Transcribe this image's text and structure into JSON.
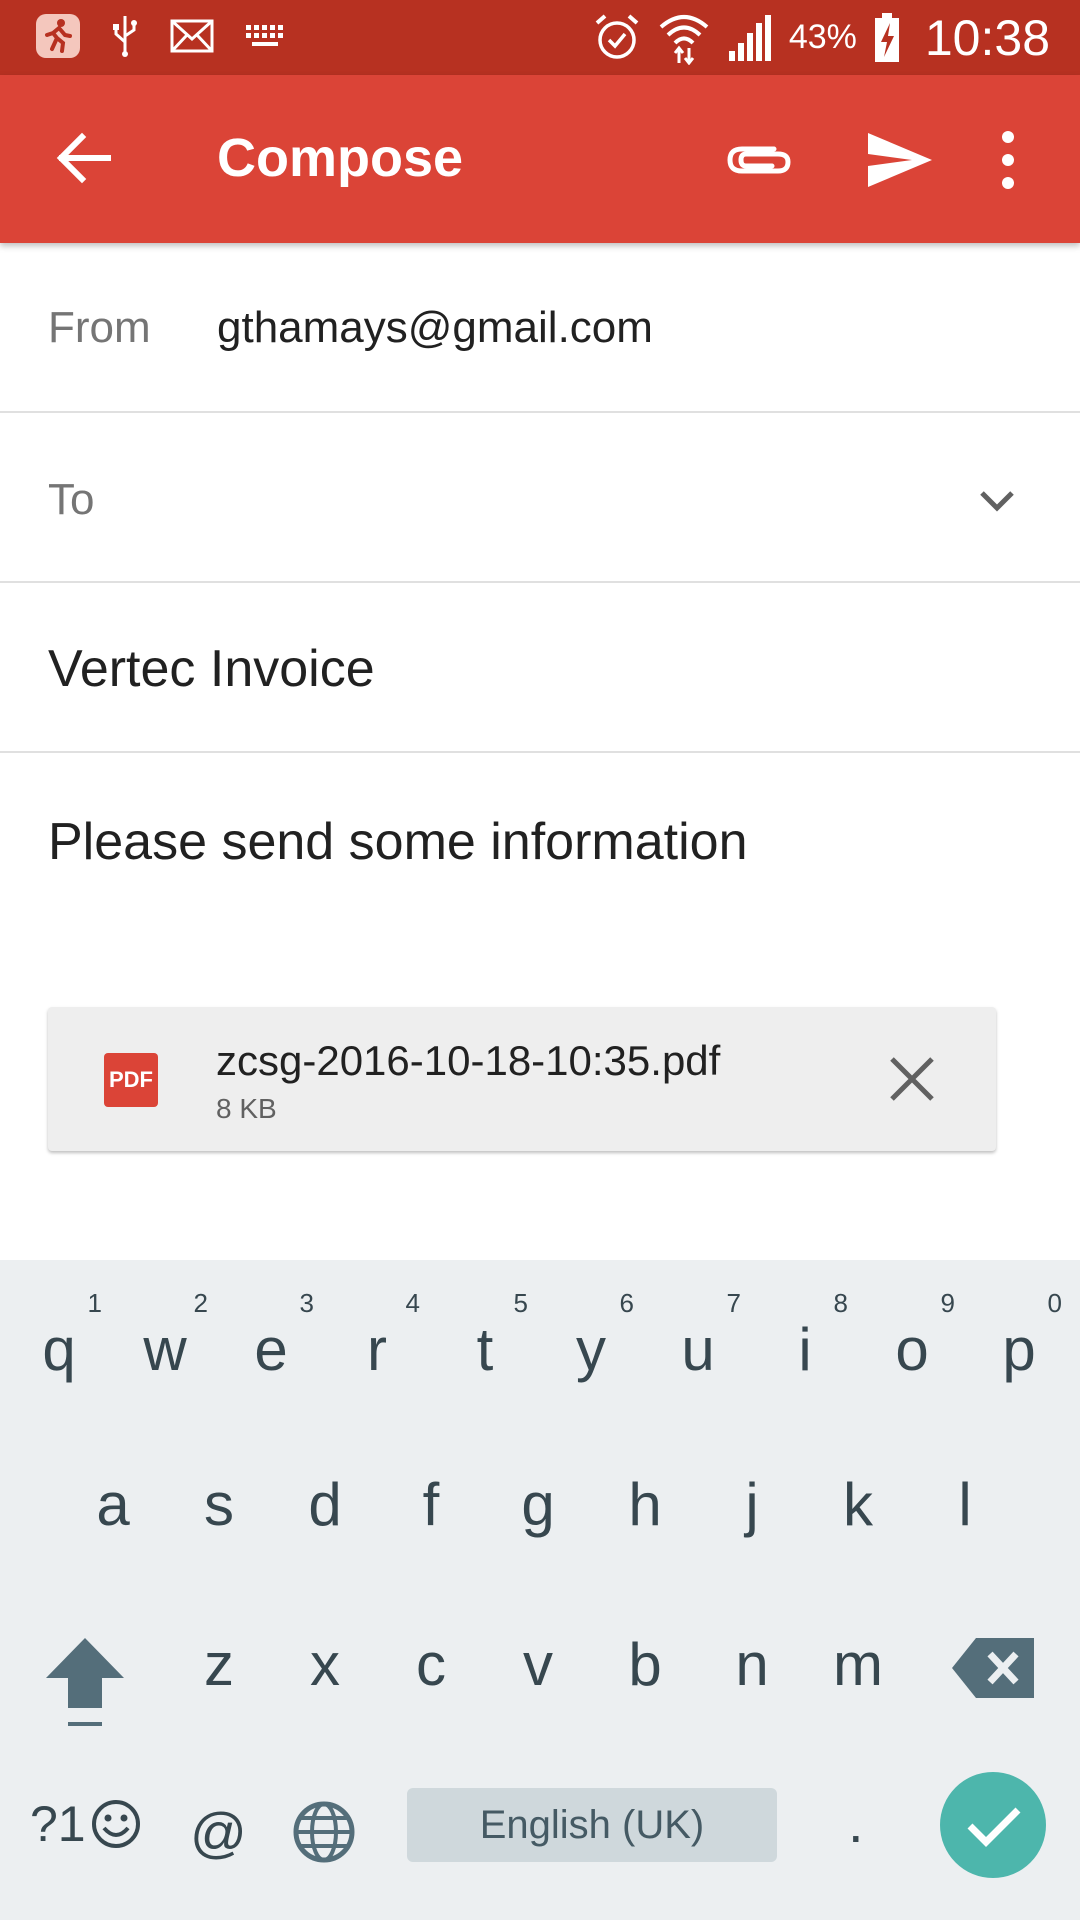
{
  "status_bar": {
    "battery_pct": "43%",
    "time": "10:38"
  },
  "appbar": {
    "title": "Compose"
  },
  "from": {
    "label": "From",
    "value": "gthamays@gmail.com"
  },
  "to": {
    "label": "To",
    "value": ""
  },
  "subject": {
    "value": "Vertec Invoice"
  },
  "body": {
    "text": "Please send some information"
  },
  "attachment": {
    "type_label": "PDF",
    "filename": "zcsg-2016-10-18-10:35.pdf",
    "size": "8 KB"
  },
  "keyboard": {
    "row1": [
      {
        "key": "q",
        "hint": "1"
      },
      {
        "key": "w",
        "hint": "2"
      },
      {
        "key": "e",
        "hint": "3"
      },
      {
        "key": "r",
        "hint": "4"
      },
      {
        "key": "t",
        "hint": "5"
      },
      {
        "key": "y",
        "hint": "6"
      },
      {
        "key": "u",
        "hint": "7"
      },
      {
        "key": "i",
        "hint": "8"
      },
      {
        "key": "o",
        "hint": "9"
      },
      {
        "key": "p",
        "hint": "0"
      }
    ],
    "row2": [
      "a",
      "s",
      "d",
      "f",
      "g",
      "h",
      "j",
      "k",
      "l"
    ],
    "row3": [
      "z",
      "x",
      "c",
      "v",
      "b",
      "n",
      "m"
    ],
    "symbols_label": "?1",
    "at_label": "@",
    "space_label": "English (UK)",
    "period_label": "."
  },
  "colors": {
    "status_bar": "#b73121",
    "app_bar": "#db4437",
    "enter_key": "#4db6ac"
  },
  "icons": [
    "running-app-icon",
    "usb-icon",
    "gmail-icon",
    "keyboard-icon",
    "alarm-icon",
    "wifi-icon",
    "signal-icon",
    "battery-charging-icon",
    "back-arrow-icon",
    "paperclip-icon",
    "send-icon",
    "more-vert-icon",
    "chevron-down-icon",
    "close-icon",
    "shift-icon",
    "backspace-icon",
    "emoji-icon",
    "globe-icon",
    "checkmark-icon"
  ]
}
